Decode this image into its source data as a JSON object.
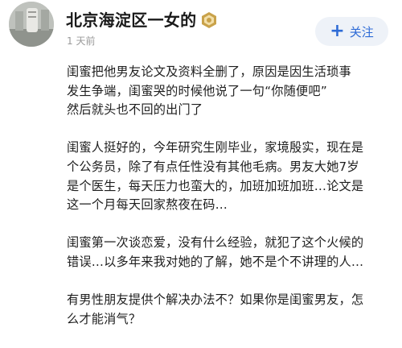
{
  "user": {
    "name": "北京海淀区一女的",
    "time": "1 天前",
    "badge_color": "#c9a24a"
  },
  "follow": {
    "plus": "+",
    "label": "关注",
    "text_color": "#2e6bd6",
    "bg_color": "#eef2f8"
  },
  "post": {
    "paragraphs": [
      [
        "闺蜜把他男友论文及资料全删了，原因是因生活琐事",
        "发生争端，闺蜜哭的时候他说了一句“你随便吧”",
        "然后就头也不回的出门了"
      ],
      [
        "闺蜜人挺好的，今年研究生刚毕业，家境殷实，现在是",
        "个公务员，除了有点任性没有其他毛病。男友大她7岁",
        "是个医生，每天压力也蛮大的，加班加班加班…论文是",
        "这一个月每天回家熬夜在码…"
      ],
      [
        "闺蜜第一次谈恋爱，没有什么经验，就犯了这个火候的",
        "错误…以多年来我对她的了解，她不是个不讲理的人…"
      ],
      [
        "有男性朋友提供个解决办法不？如果你是闺蜜男友，怎",
        "么才能消气？"
      ]
    ]
  }
}
